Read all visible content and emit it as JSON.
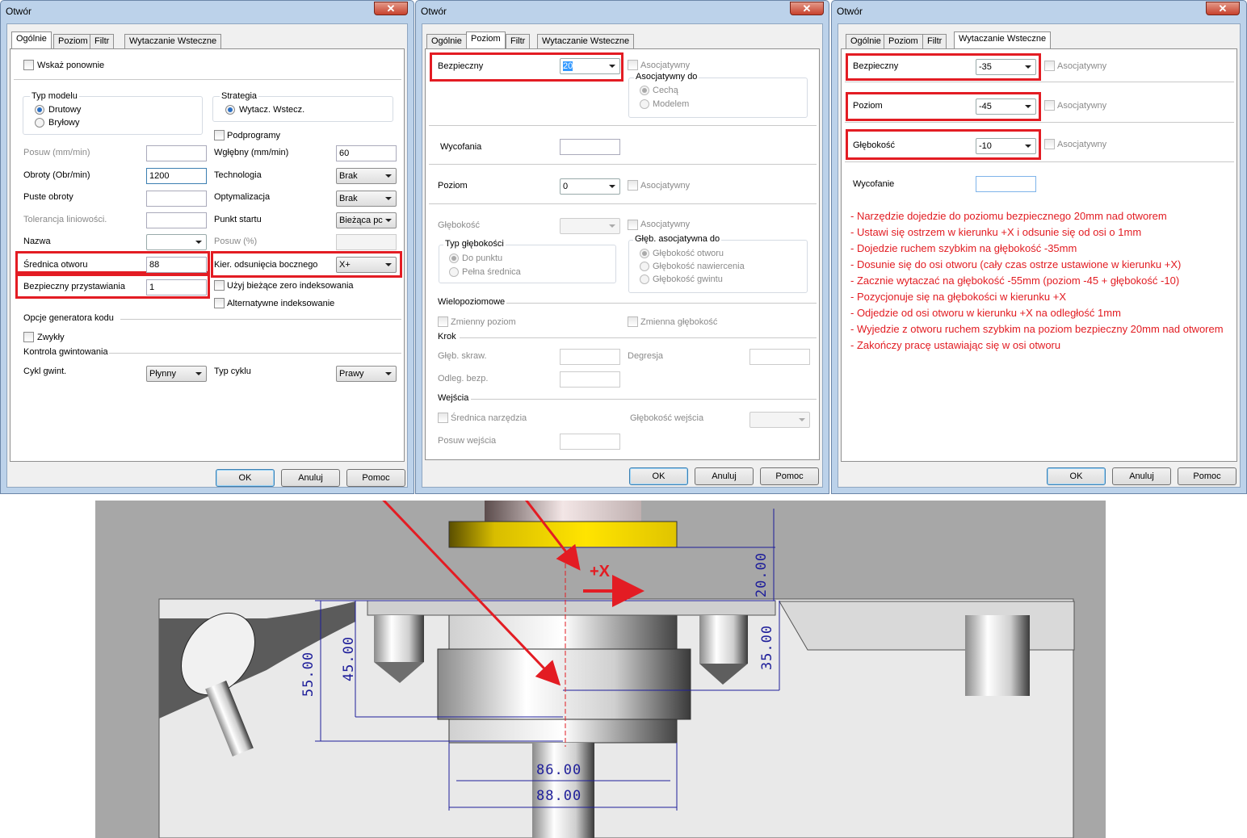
{
  "win1": {
    "title": "Otwór",
    "close": "✕",
    "tabs": [
      "Ogólnie",
      "Poziom",
      "Filtr",
      "Wytaczanie Wsteczne"
    ],
    "show_again": "Wskaż ponownie",
    "model_type": {
      "label": "Typ modelu",
      "opt1": "Drutowy",
      "opt2": "Bryłowy"
    },
    "strategy": {
      "label": "Strategia",
      "opt1": "Wytacz. Wstecz."
    },
    "subprograms": "Podprogramy",
    "feed": "Posuw (mm/min)",
    "plunge": {
      "label": "Wgłębny (mm/min)",
      "value": "60"
    },
    "rpm": {
      "label": "Obroty (Obr/min)",
      "value": "1200"
    },
    "technology": {
      "label": "Technologia",
      "value": "Brak"
    },
    "idle_rpm": "Puste obroty",
    "optimization": {
      "label": "Optymalizacja",
      "value": "Brak"
    },
    "linear_tol": "Tolerancja liniowości.",
    "start_point": {
      "label": "Punkt startu",
      "value": "Bieżąca pc"
    },
    "name": "Nazwa",
    "feed_pct": "Posuw (%)",
    "hole_diam": {
      "label": "Średnica otworu",
      "value": "88"
    },
    "side_dir": {
      "label": "Kier. odsunięcia bocznego",
      "value": "X+"
    },
    "safe_approach": {
      "label": "Bezpieczny przystawiania",
      "value": "1"
    },
    "use_zero": "Użyj bieżące zero indeksowania",
    "alt_index": "Alternatywne indeksowanie",
    "codegen": "Opcje generatora kodu",
    "ordinary": "Zwykły",
    "thread_ctrl": "Kontrola gwintowania",
    "thread_cycle": {
      "label": "Cykl gwint.",
      "value": "Płynny"
    },
    "cycle_type": {
      "label": "Typ cyklu",
      "value": "Prawy"
    },
    "ok": "OK",
    "cancel": "Anuluj",
    "help": "Pomoc"
  },
  "win2": {
    "title": "Otwór",
    "close": "✕",
    "tabs": [
      "Ogólnie",
      "Poziom",
      "Filtr",
      "Wytaczanie Wsteczne"
    ],
    "safe": {
      "label": "Bezpieczny",
      "value": "20"
    },
    "assoc": "Asocjatywny",
    "assoc_to": "Asocjatywny do",
    "feature": "Cechą",
    "model": "Modelem",
    "retract": "Wycofania",
    "level": {
      "label": "Poziom",
      "value": "0"
    },
    "depth": "Głębokość",
    "depth_type": "Typ głębokości",
    "to_point": "Do punktu",
    "full_diam": "Pełna średnica",
    "depth_assoc": "Głęb. asocjatywna do",
    "hole_depth": "Głębokość otworu",
    "drill_depth": "Głębokość nawiercenia",
    "thread_depth": "Głębokość gwintu",
    "multilevel": "Wielopoziomowe",
    "var_level": "Zmienny poziom",
    "var_depth": "Zmienna głębokość",
    "step": "Krok",
    "cut_depth": "Głęb. skraw.",
    "degression": "Degresja",
    "safe_dist": "Odleg. bezp.",
    "entry": "Wejścia",
    "tool_diam": "Średnica narzędzia",
    "entry_depth": "Głębokość wejścia",
    "entry_feed": "Posuw wejścia",
    "ok": "OK",
    "cancel": "Anuluj",
    "help": "Pomoc"
  },
  "win3": {
    "title": "Otwór",
    "close": "✕",
    "tabs": [
      "Ogólnie",
      "Poziom",
      "Filtr",
      "Wytaczanie Wsteczne"
    ],
    "safe": {
      "label": "Bezpieczny",
      "value": "-35"
    },
    "level": {
      "label": "Poziom",
      "value": "-45"
    },
    "depth": {
      "label": "Głębokość",
      "value": "-10"
    },
    "assoc": "Asocjatywny",
    "retract": "Wycofanie",
    "notes": [
      "- Narzędzie dojedzie do poziomu bezpiecznego 20mm nad otworem",
      "- Ustawi się ostrzem w kierunku +X i odsunie się od osi o 1mm",
      "- Dojedzie ruchem szybkim na głębokość -35mm",
      "- Dosunie się do osi otworu (cały czas ostrze ustawione w kierunku +X)",
      "- Zacznie wytaczać na głębokość -55mm (poziom -45 + głębokość -10)",
      "- Pozycjonuje się na głębokości w kierunku +X",
      "- Odjedzie od osi otworu w kierunku +X na odległość 1mm",
      "- Wyjedzie z otworu ruchem szybkim na poziom bezpieczny 20mm nad otworem",
      "- Zakończy pracę ustawiając się w osi otworu"
    ],
    "ok": "OK",
    "cancel": "Anuluj",
    "help": "Pomoc"
  },
  "cad": {
    "plus_x": "+X",
    "d20": "20.00",
    "d35": "35.00",
    "d45": "45.00",
    "d55": "55.00",
    "d86": "86.00",
    "d88": "88.00"
  },
  "colors": {
    "highlight": "#e31c23",
    "dimension": "#1e1e9a",
    "tool_yellow": "#e8cf00"
  }
}
